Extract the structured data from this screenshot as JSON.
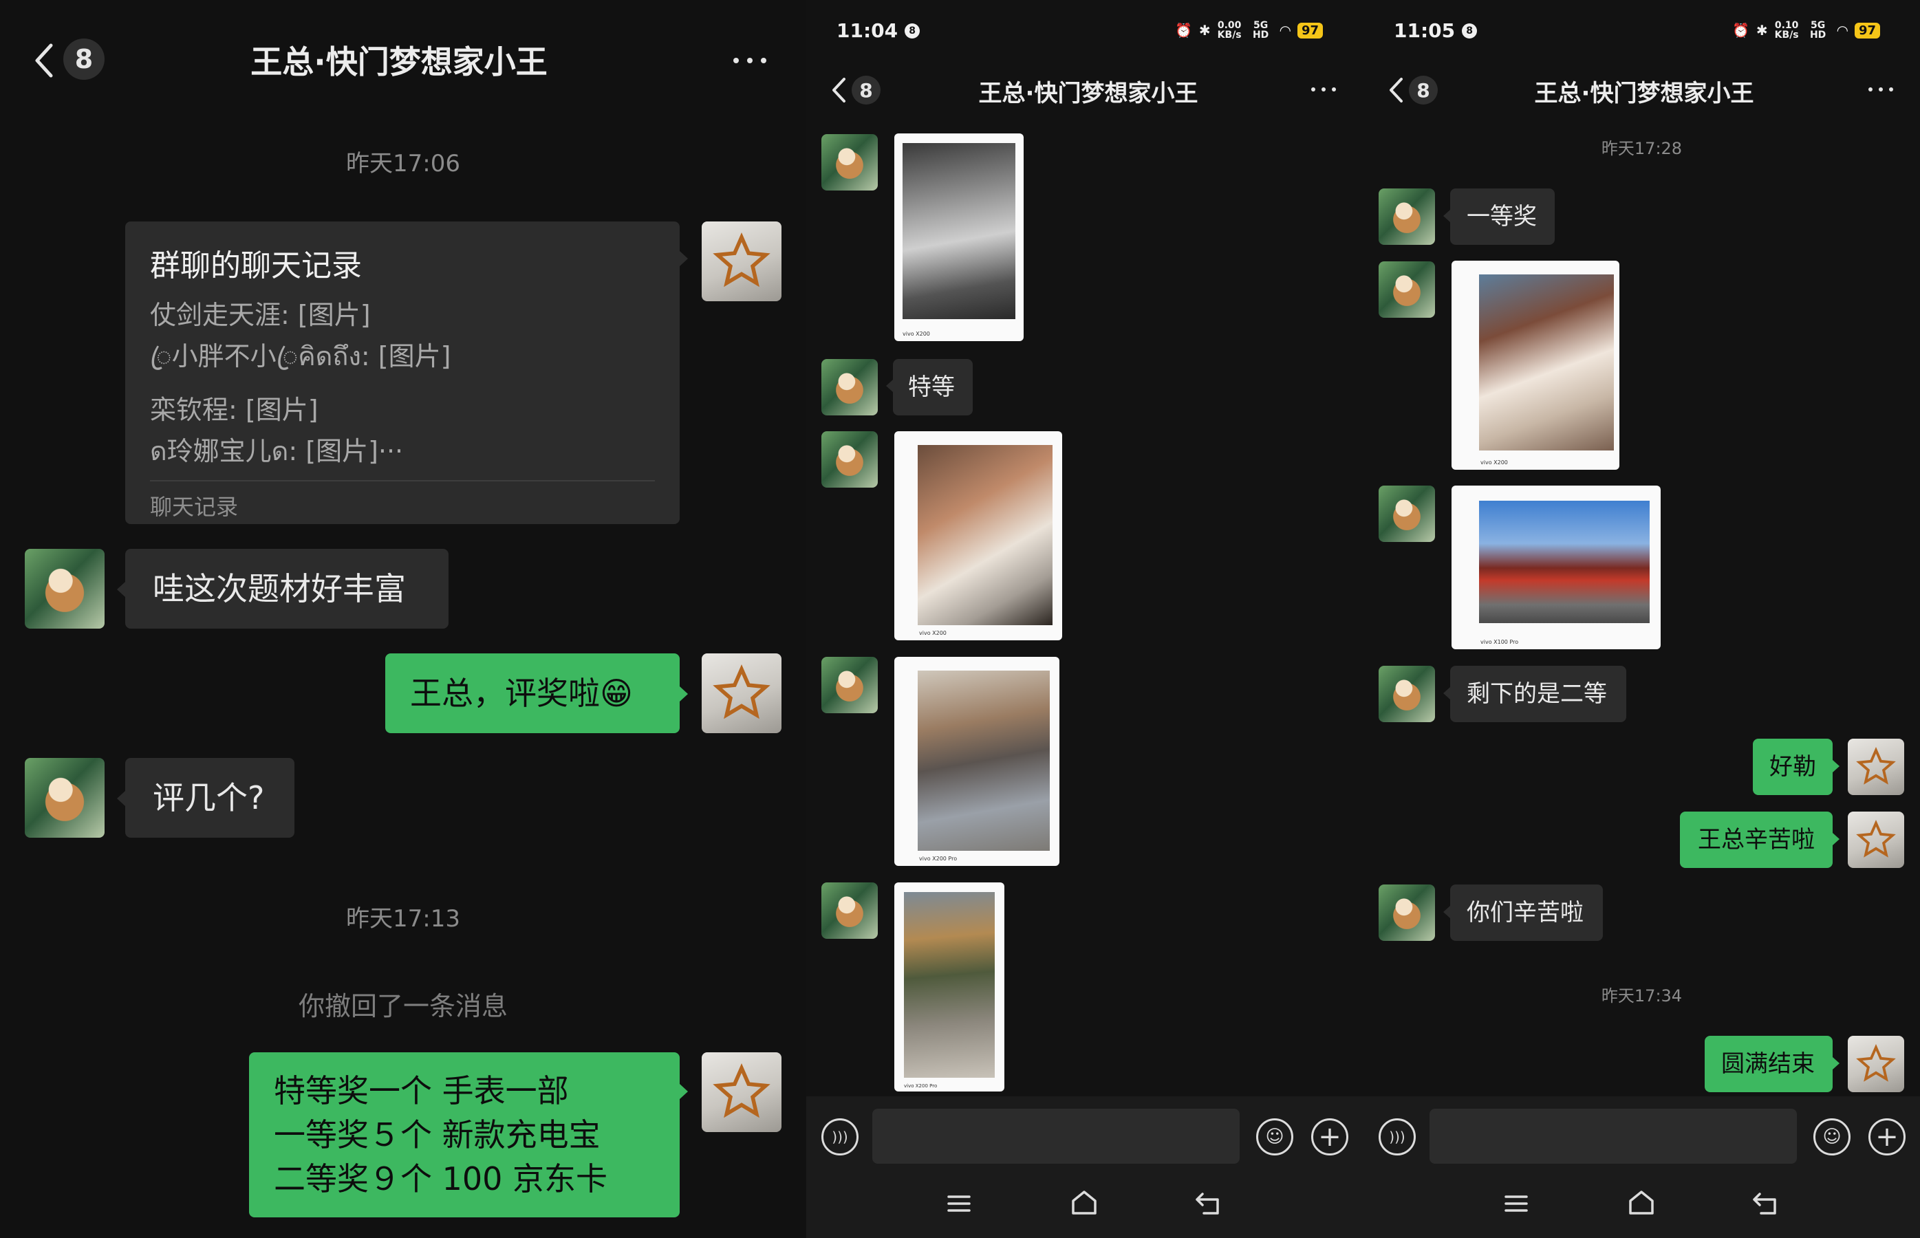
{
  "panel1": {
    "header": {
      "unread": "8",
      "title": "王总·快门梦想家小王"
    },
    "timestamps": [
      "昨天17:06",
      "昨天17:13"
    ],
    "chat_record": {
      "title": "群聊的聊天记录",
      "lines": [
        "仗剑走天涯: [图片]",
        "ꦿ小胖不小ꦿคิดถึง: [图片]",
        "栾钦程: [图片]",
        "ด玲娜宝儿ด: [图片]···"
      ],
      "footer": "聊天记录"
    },
    "messages": {
      "m1": "哇这次题材好丰富",
      "m2": "王总，评奖啦😁",
      "m3": "评几个?"
    },
    "recall": "你撤回了一条消息",
    "prize": {
      "line1": "特等奖一个 手表一部",
      "line2": "一等奖５个 新款充电宝",
      "line3": "二等奖９个 100 京东卡"
    }
  },
  "panel2": {
    "status": {
      "time": "11:04",
      "speed": "0.00",
      "speed_unit": "KB/s",
      "net": "5G HD",
      "battery": "97"
    },
    "header": {
      "unread": "8",
      "title": "王总·快门梦想家小王"
    },
    "messages": {
      "m1": "特等"
    },
    "photo_brands": [
      "vivo X200",
      "vivo X200",
      "vivo X200 Pro",
      "vivo X200 Pro"
    ]
  },
  "panel3": {
    "status": {
      "time": "11:05",
      "speed": "0.10",
      "speed_unit": "KB/s",
      "net": "5G HD",
      "battery": "97"
    },
    "header": {
      "unread": "8",
      "title": "王总·快门梦想家小王"
    },
    "timestamps": [
      "昨天17:28",
      "昨天17:34"
    ],
    "messages": {
      "m1": "一等奖",
      "m2": "剩下的是二等",
      "m3": "好勒",
      "m4": "王总辛苦啦",
      "m5": "你们辛苦啦",
      "m6": "圆满结束"
    },
    "photo_brands": [
      "vivo X200",
      "vivo X100 Pro"
    ]
  },
  "colors": {
    "bg": "#111111",
    "bubble_grey": "#2c2c2c",
    "bubble_green": "#3db860",
    "battery": "#f5c518"
  }
}
